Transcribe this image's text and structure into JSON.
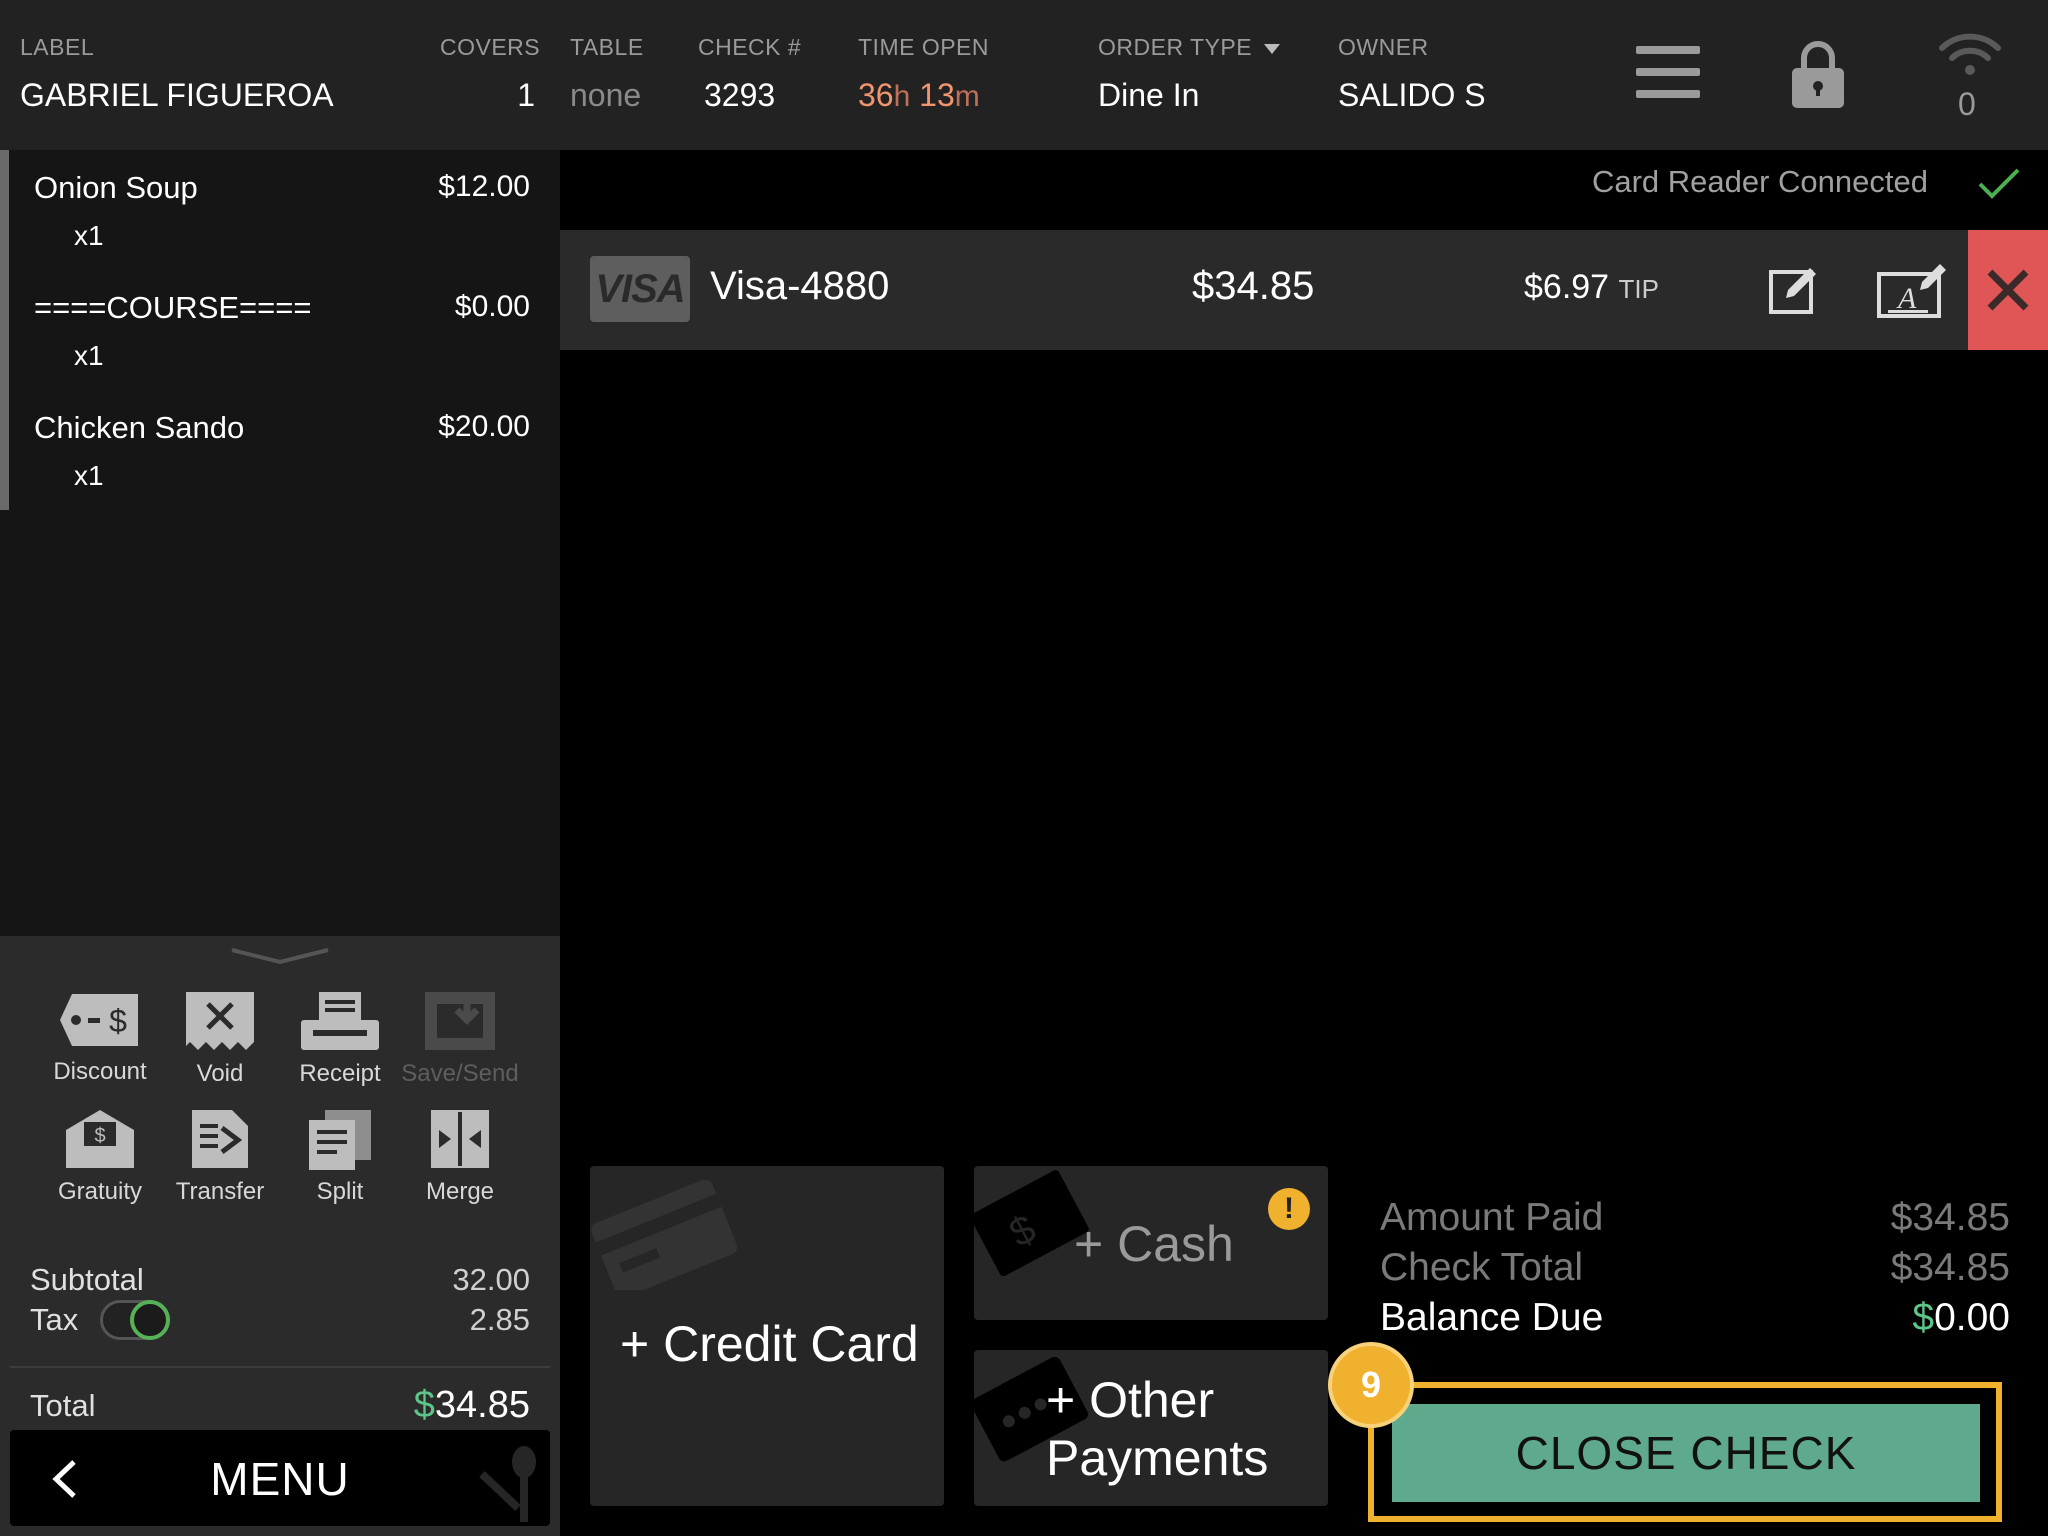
{
  "header": {
    "label": {
      "title": "LABEL",
      "value": "GABRIEL FIGUEROA"
    },
    "covers": {
      "title": "COVERS",
      "value": "1"
    },
    "table": {
      "title": "TABLE",
      "value": "none"
    },
    "check": {
      "title": "CHECK #",
      "value": "3293"
    },
    "time_open": {
      "title": "TIME OPEN",
      "hours": "36",
      "hours_unit": "h",
      "minutes": "13",
      "minutes_unit": "m"
    },
    "order_type": {
      "title": "ORDER TYPE",
      "value": "Dine In"
    },
    "owner": {
      "title": "OWNER",
      "value": "SALIDO S"
    },
    "icons": [
      "hamburger-menu-icon",
      "lock-icon",
      "wifi-icon"
    ],
    "wifi_count": "0"
  },
  "order_items": [
    {
      "name": "Onion Soup",
      "price": "$12.00",
      "qty": "x1"
    },
    {
      "name": "====COURSE====",
      "price": "$0.00",
      "qty": "x1"
    },
    {
      "name": "Chicken Sando",
      "price": "$20.00",
      "qty": "x1"
    }
  ],
  "actions": {
    "discount": "Discount",
    "void": "Void",
    "receipt": "Receipt",
    "save_send": "Save/Send",
    "gratuity": "Gratuity",
    "transfer": "Transfer",
    "split": "Split",
    "merge": "Merge"
  },
  "totals": {
    "subtotal_label": "Subtotal",
    "subtotal_value": "32.00",
    "tax_label": "Tax",
    "tax_value": "2.85",
    "tax_enabled": true,
    "total_label": "Total",
    "total_currency": "$",
    "total_value": "34.85"
  },
  "menu_button": "MENU",
  "card_reader": {
    "status": "Card Reader Connected"
  },
  "payment": {
    "brand": "VISA",
    "card": "Visa-4880",
    "amount": "$34.85",
    "tip": "$6.97",
    "tip_label": "TIP"
  },
  "tiles": {
    "credit_card": "+ Credit Card",
    "cash": "+ Cash",
    "cash_warning": "!",
    "other_line1": "+ Other",
    "other_line2": "Payments"
  },
  "summary": {
    "amount_paid_label": "Amount Paid",
    "amount_paid": "$34.85",
    "check_total_label": "Check Total",
    "check_total": "$34.85",
    "balance_due_label": "Balance Due",
    "balance_currency": "$",
    "balance_due": "0.00"
  },
  "close_check": "CLOSE CHECK",
  "step_badge": "9",
  "colors": {
    "accent_green": "#5faa8d",
    "highlight_yellow": "#f0b12e",
    "remove_red": "#e05555",
    "time_orange": "#f0956e"
  }
}
